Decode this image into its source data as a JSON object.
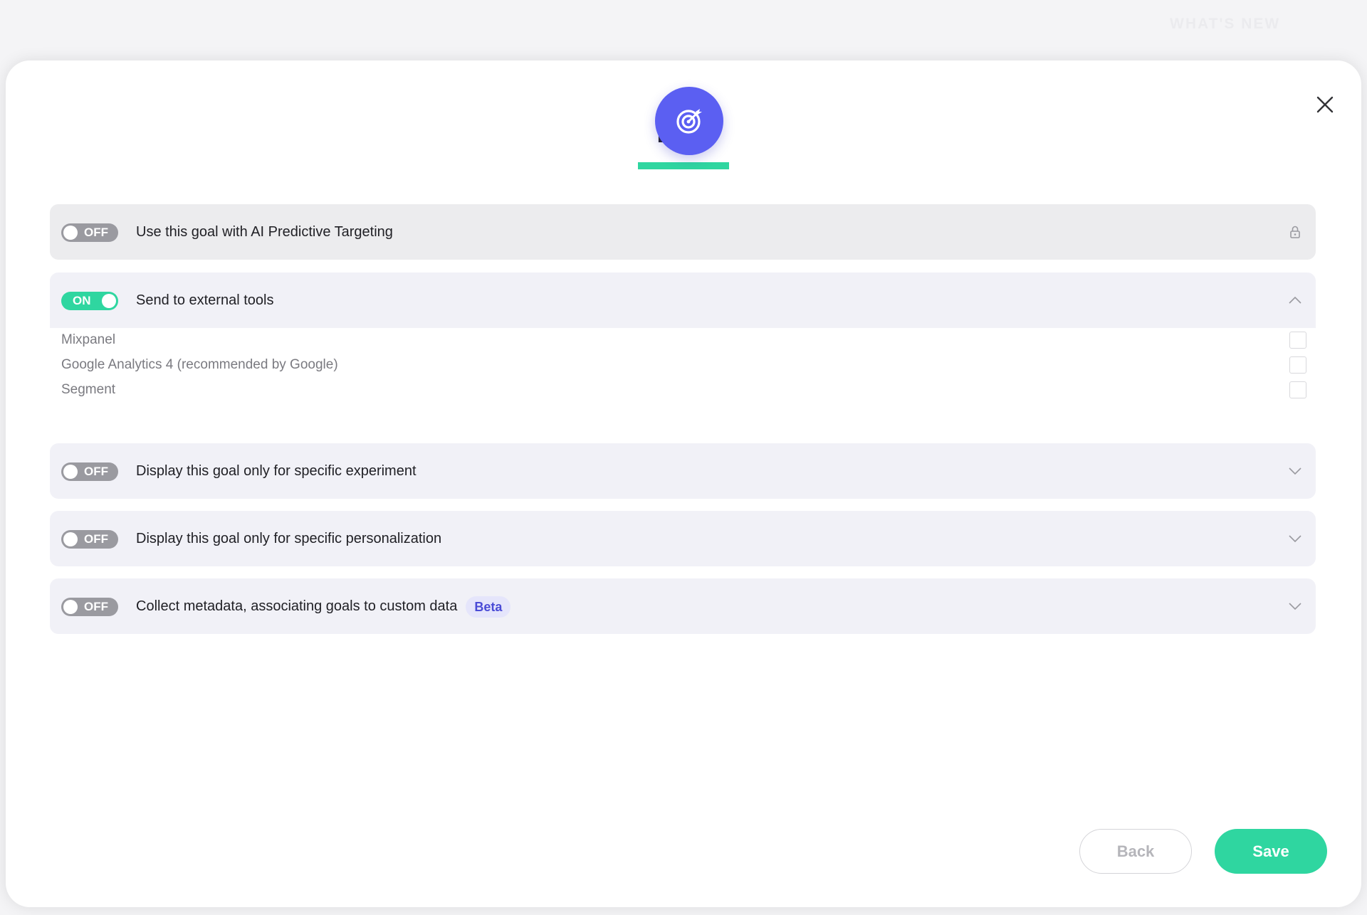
{
  "background_hint": "WHAT'S NEW",
  "modal": {
    "title": "Edit",
    "close_icon": "close-icon",
    "header_icon": "target-icon"
  },
  "colors": {
    "accent_green": "#2fd6a0",
    "accent_purple": "#5b5ff2",
    "toggle_off": "#9a9aa0",
    "beta_text": "#4a4bd6"
  },
  "rows": [
    {
      "toggle": "OFF",
      "label": "Use this goal with AI Predictive Targeting",
      "icon": "lock-icon"
    },
    {
      "toggle": "ON",
      "label": "Send to external tools",
      "icon": "chevron-up-icon"
    },
    {
      "toggle": "OFF",
      "label": "Display this goal only for specific experiment",
      "icon": "chevron-down-icon"
    },
    {
      "toggle": "OFF",
      "label": "Display this goal only for specific personalization",
      "icon": "chevron-down-icon"
    },
    {
      "toggle": "OFF",
      "label": "Collect metadata, associating goals to custom data",
      "badge": "Beta",
      "icon": "chevron-down-icon"
    }
  ],
  "external_tools": [
    {
      "label": "Mixpanel",
      "checked": false
    },
    {
      "label": "Google Analytics 4 (recommended by Google)",
      "checked": false
    },
    {
      "label": "Segment",
      "checked": false
    }
  ],
  "footer": {
    "back_label": "Back",
    "save_label": "Save"
  }
}
